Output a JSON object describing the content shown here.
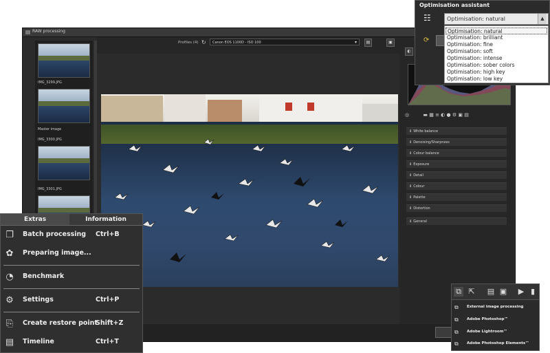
{
  "raw_window": {
    "title": "RAW processing",
    "profiles_label": "Profiles (4)",
    "profile_value": "Canon EOS 1100D - ISO 100",
    "right_top_button": "◐"
  },
  "sidebar": {
    "thumbnails": [
      {
        "label": ""
      },
      {
        "label": "IMG_3299.JPG",
        "caption": "Master image"
      },
      {
        "label": "IMG_3300.JPG"
      },
      {
        "label": "IMG_3301.JPG"
      }
    ]
  },
  "right_panel": {
    "sections": [
      "White balance",
      "Denoising/Sharpness",
      "Colour balance",
      "Exposure",
      "Detail",
      "Colour",
      "Palette",
      "Distortion",
      "General"
    ]
  },
  "optimisation_assistant": {
    "title": "Optimisation assistant",
    "selected": "Optimisation: natural",
    "options": [
      "Optimisation: natural",
      "Optimisation: brilliant",
      "Optimisation: fine",
      "Optimisation: soft",
      "Optimisation: intense",
      "Optimisation: sober colors",
      "Optimisation: high key",
      "Optimisation: low key"
    ]
  },
  "extras_menu": {
    "tabs": {
      "extras": "Extras",
      "information": "Information"
    },
    "items": [
      {
        "label": "Batch processing",
        "shortcut": "Ctrl+B",
        "icon": "stack-icon"
      },
      {
        "label": "Preparing image...",
        "shortcut": "",
        "icon": "palette-icon"
      },
      {
        "label": "Benchmark",
        "shortcut": "",
        "icon": "gauge-icon"
      },
      {
        "label": "Settings",
        "shortcut": "Ctrl+P",
        "icon": "gears-icon"
      },
      {
        "label": "Create restore point",
        "shortcut": "Shift+Z",
        "icon": "restore-icon"
      },
      {
        "label": "Timeline",
        "shortcut": "Ctrl+T",
        "icon": "timeline-icon"
      }
    ]
  },
  "external_processing": {
    "items": [
      "External image processing",
      "Adobe Photoshop™",
      "Adobe Lightroom™",
      "Adobe Photoshop Elements™"
    ]
  }
}
